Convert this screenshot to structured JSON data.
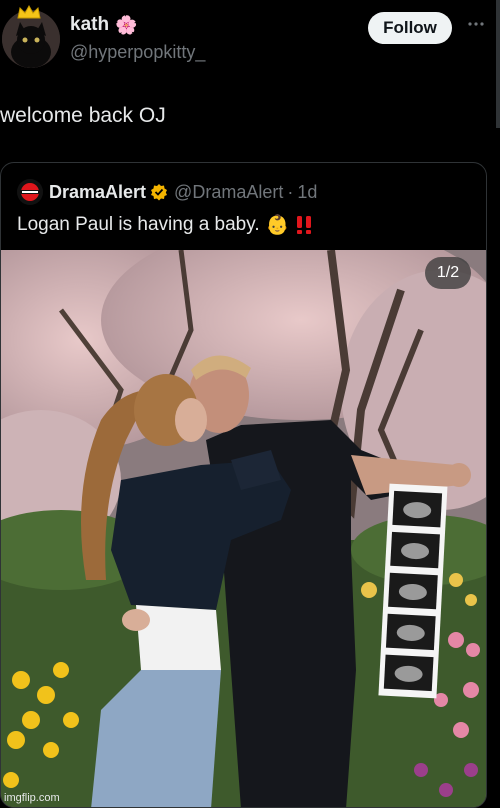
{
  "tweet": {
    "display_name": "kath",
    "name_emoji": "🌸",
    "handle": "@hyperpopkitty_",
    "follow_label": "Follow",
    "text": "welcome back OJ"
  },
  "quote": {
    "display_name": "DramaAlert",
    "handle": "@DramaAlert",
    "separator": "·",
    "time": "1d",
    "text": "Logan Paul is having a baby.",
    "baby_emoji": "👶",
    "counter": "1/2"
  },
  "watermark": "imgflip.com",
  "colors": {
    "background": "#000000",
    "text": "#e7e9ea",
    "muted": "#71767b",
    "verified": "#f4b400",
    "alert_red": "#e0161c"
  },
  "icons": [
    "crown-icon",
    "cat-avatar",
    "flower-icon",
    "more-icon",
    "dramaalert-logo",
    "verified-badge-icon",
    "baby-emoji",
    "double-exclamation-icon"
  ]
}
